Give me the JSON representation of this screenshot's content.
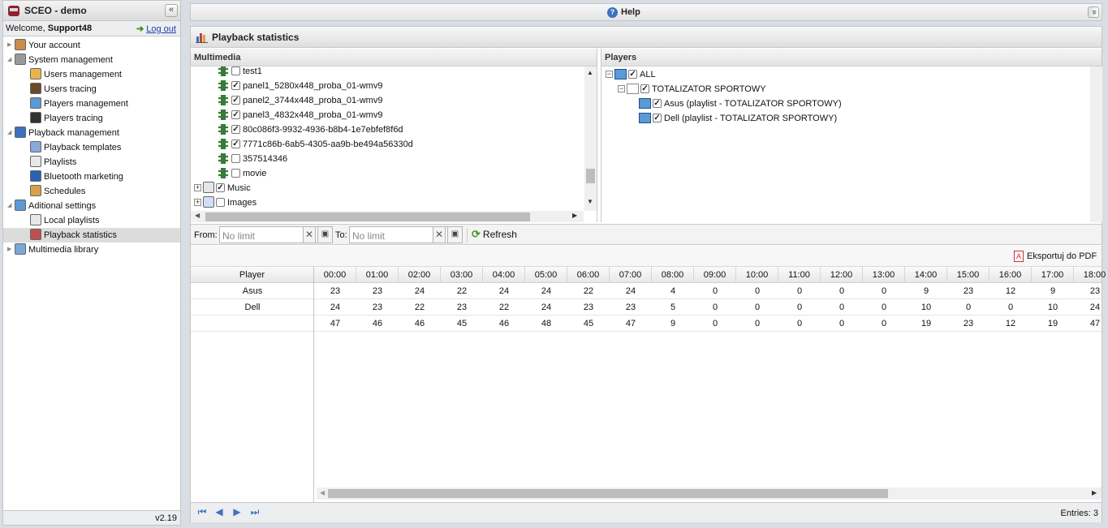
{
  "app": {
    "title": "SCEO - demo",
    "collapse_glyph": "«"
  },
  "user": {
    "welcome_prefix": "Welcome, ",
    "name": "Support48",
    "logout": "Log out"
  },
  "nav": [
    {
      "label": "Your account",
      "level": 0,
      "toggle": "▶",
      "icon": "user-icon",
      "color": "#c98c4a"
    },
    {
      "label": "System management",
      "level": 0,
      "toggle": "◢",
      "icon": "gear-icon",
      "color": "#9a9a9a"
    },
    {
      "label": "Users management",
      "level": 1,
      "toggle": "",
      "icon": "users-icon",
      "color": "#e7b54a"
    },
    {
      "label": "Users tracing",
      "level": 1,
      "toggle": "",
      "icon": "agent-icon",
      "color": "#6a4a2a"
    },
    {
      "label": "Players management",
      "level": 1,
      "toggle": "",
      "icon": "tv-icon",
      "color": "#5a9ad6"
    },
    {
      "label": "Players tracing",
      "level": 1,
      "toggle": "",
      "icon": "tv-dark-icon",
      "color": "#333333"
    },
    {
      "label": "Playback management",
      "level": 0,
      "toggle": "◢",
      "icon": "play-icon",
      "color": "#3c6fbe"
    },
    {
      "label": "Playback templates",
      "level": 1,
      "toggle": "",
      "icon": "template-icon",
      "color": "#8aa8d8"
    },
    {
      "label": "Playlists",
      "level": 1,
      "toggle": "",
      "icon": "document-icon",
      "color": "#e8e8e8"
    },
    {
      "label": "Bluetooth marketing",
      "level": 1,
      "toggle": "",
      "icon": "bluetooth-icon",
      "color": "#2a62b6"
    },
    {
      "label": "Schedules",
      "level": 1,
      "toggle": "",
      "icon": "calendar-icon",
      "color": "#d8a04a"
    },
    {
      "label": "Aditional settings",
      "level": 0,
      "toggle": "◢",
      "icon": "tv-icon",
      "color": "#5a9ad6"
    },
    {
      "label": "Local playlists",
      "level": 1,
      "toggle": "",
      "icon": "document-icon",
      "color": "#e8e8e8"
    },
    {
      "label": "Playback statistics",
      "level": 1,
      "toggle": "",
      "icon": "chart-icon",
      "color": "#c05050",
      "selected": true
    },
    {
      "label": "Multimedia library",
      "level": 0,
      "toggle": "▶",
      "icon": "library-icon",
      "color": "#7aa8d8"
    }
  ],
  "version": "v2.19",
  "help": {
    "label": "Help",
    "collapse_glyph": "»"
  },
  "page": {
    "title": "Playback statistics"
  },
  "multimedia": {
    "title": "Multimedia",
    "items": [
      {
        "label": "test1",
        "type": "video",
        "checked": false
      },
      {
        "label": "panel1_5280x448_proba_01-wmv9",
        "type": "video",
        "checked": true
      },
      {
        "label": "panel2_3744x448_proba_01-wmv9",
        "type": "video",
        "checked": true
      },
      {
        "label": "panel3_4832x448_proba_01-wmv9",
        "type": "video",
        "checked": true
      },
      {
        "label": "80c086f3-9932-4936-b8b4-1e7ebfef8f6d",
        "type": "video",
        "checked": true
      },
      {
        "label": "7771c86b-6ab5-4305-aa9b-be494a56330d",
        "type": "video",
        "checked": true
      },
      {
        "label": "357514346",
        "type": "video",
        "checked": false
      },
      {
        "label": "movie",
        "type": "video",
        "checked": false
      },
      {
        "label": "Music",
        "type": "music-folder",
        "checked": true
      },
      {
        "label": "Images",
        "type": "image-folder",
        "checked": false
      }
    ]
  },
  "players": {
    "title": "Players",
    "items": [
      {
        "label": "ALL",
        "level": 0,
        "checked": true,
        "toggle": "⊟"
      },
      {
        "label": "TOTALIZATOR SPORTOWY",
        "level": 1,
        "checked": true,
        "toggle": "⊟"
      },
      {
        "label": "Asus (playlist - TOTALIZATOR SPORTOWY)",
        "level": 2,
        "checked": true
      },
      {
        "label": "Dell (playlist - TOTALIZATOR SPORTOWY)",
        "level": 2,
        "checked": true
      }
    ]
  },
  "filters": {
    "from_label": "From:",
    "from_placeholder": "No limit",
    "to_label": "To:",
    "to_placeholder": "No limit",
    "clear_glyph": "✕",
    "refresh": "Refresh"
  },
  "export_pdf": "Eksportuj do PDF",
  "grid": {
    "player_header": "Player",
    "hours": [
      "00:00",
      "01:00",
      "02:00",
      "03:00",
      "04:00",
      "05:00",
      "06:00",
      "07:00",
      "08:00",
      "09:00",
      "10:00",
      "11:00",
      "12:00",
      "13:00",
      "14:00",
      "15:00",
      "16:00",
      "17:00",
      "18:00"
    ],
    "rows": [
      {
        "player": "Asus",
        "values": [
          23,
          23,
          24,
          22,
          24,
          24,
          22,
          24,
          4,
          0,
          0,
          0,
          0,
          0,
          9,
          23,
          12,
          9,
          23
        ]
      },
      {
        "player": "Dell",
        "values": [
          24,
          23,
          22,
          23,
          22,
          24,
          23,
          23,
          5,
          0,
          0,
          0,
          0,
          0,
          10,
          0,
          0,
          10,
          24
        ]
      },
      {
        "player": "",
        "values": [
          47,
          46,
          46,
          45,
          46,
          48,
          45,
          47,
          9,
          0,
          0,
          0,
          0,
          0,
          19,
          23,
          12,
          19,
          47
        ]
      }
    ]
  },
  "pager": {
    "first": "⏮",
    "prev": "◀",
    "next": "▶",
    "last": "⏭",
    "entries_label": "Entries:",
    "entries_count": "3"
  }
}
